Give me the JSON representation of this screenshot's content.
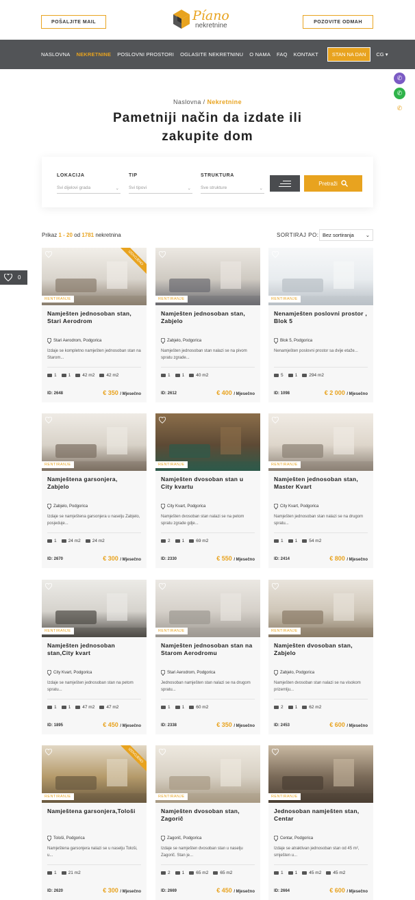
{
  "header": {
    "left_button": "POŠALJITE MAIL",
    "right_button": "POZOVITE ODMAH",
    "logo_main": "Píano",
    "logo_sub": "nekretnine"
  },
  "nav": {
    "items": [
      "NASLOVNA",
      "NEKRETNINE",
      "POSLOVNI PROSTORI",
      "OGLASITE NEKRETNINU",
      "O NAMA",
      "FAQ",
      "KONTAKT"
    ],
    "cta": "STAN NA DAN",
    "lang": "CG"
  },
  "favorites": {
    "count": "0"
  },
  "breadcrumb": {
    "home": "Naslovna",
    "sep": " / ",
    "current": "Nekretnine"
  },
  "hero": {
    "line1": "Pametniji način da izdate ili",
    "line2": "zakupite dom"
  },
  "search": {
    "location_label": "LOKACIJA",
    "location_value": "Svi dijelovi grada",
    "type_label": "TIP",
    "type_value": "Svi tipovi",
    "structure_label": "STRUKTURA",
    "structure_value": "Sve strukture",
    "submit": "Pretraži"
  },
  "results": {
    "prefix": "Prikaz",
    "from": "1",
    "dash": " - ",
    "to": "20",
    "of": "od",
    "total": "1781",
    "suffix": "nekretnina"
  },
  "sort": {
    "label": "SORTIRAJ PO:",
    "value": "Bez sortiranja"
  },
  "colors": {
    "accent": "#e8a31f",
    "nav": "#525457"
  },
  "listings": [
    {
      "title": "Namješten jednosoban stan, Stari Aerodrom",
      "location": "Stari Aerodrom, Podgorica",
      "desc": "Izdaje se kompletno namješten jednosoban stan na Starom...",
      "badge": "RENTIRANJE",
      "ribbon": "IZDVOJENO",
      "features": [
        "1",
        "1",
        "42 m2",
        "42 m2"
      ],
      "id": "ID: 2648",
      "price": "€ 350",
      "per": "/ Mjesečno"
    },
    {
      "title": "Namješten jednosoban stan, Zabjelo",
      "location": "Zabjelo, Podgorica",
      "desc": "Namješten jednosoban stan nalazi se na pivom spratu zgrade...",
      "badge": "RENTIRANJE",
      "ribbon": "",
      "features": [
        "1",
        "1",
        "40 m2"
      ],
      "id": "ID: 2612",
      "price": "€ 400",
      "per": "/ Mjesečno"
    },
    {
      "title": "Nenamješten poslovni prostor , Blok 5",
      "location": "Blok 5, Podgorica",
      "desc": "Nenamješten poslovni prostor sa dvije etaže...",
      "badge": "RENTIRANJE",
      "ribbon": "",
      "features": [
        "5",
        "1",
        "294 m2"
      ],
      "id": "ID: 1098",
      "price": "€ 2 000",
      "per": "/ Mjesečno"
    },
    {
      "title": "Namještena garsonjera, Zabjelo",
      "location": "Zabjelo, Podgorica",
      "desc": "Izdaje se namještena garsonjera u naselju Zabjelo, posjeduje...",
      "badge": "RENTIRANJE",
      "ribbon": "",
      "features": [
        "1",
        "24 m2",
        "24 m2"
      ],
      "id": "ID: 2670",
      "price": "€ 300",
      "per": "/ Mjesečno"
    },
    {
      "title": "Namješten dvosoban stan u City kvartu",
      "location": "City Kvart, Podgorica",
      "desc": "Namješten dvosoban stan nalazi se na petom spratu zgrade gdje...",
      "badge": "RENTIRANJE",
      "ribbon": "",
      "features": [
        "2",
        "1",
        "69 m2"
      ],
      "id": "ID: 2330",
      "price": "€ 550",
      "per": "/ Mjesečno"
    },
    {
      "title": "Namješten jednosoban stan, Master Kvart",
      "location": "City Kvart, Podgorica",
      "desc": "Namješten jednosoban stan nalazi se na drugom spratu...",
      "badge": "RENTIRANJE",
      "ribbon": "",
      "features": [
        "1",
        "1",
        "54 m2"
      ],
      "id": "ID: 2414",
      "price": "€ 800",
      "per": "/ Mjesečno"
    },
    {
      "title": "Namješten jednosoban stan,City kvart",
      "location": "City Kvart, Podgorica",
      "desc": "Izdaje se namješten jednosoban stan na petom spratu...",
      "badge": "RENTIRANJE",
      "ribbon": "",
      "features": [
        "1",
        "1",
        "47 m2",
        "47 m2"
      ],
      "id": "ID: 1895",
      "price": "€ 450",
      "per": "/ Mjesečno"
    },
    {
      "title": "Namješten jednosoban stan na Starom Aerodromu",
      "location": "Stari Aerodrom, Podgorica",
      "desc": "Jednosoban namješten stan nalazi se na drugom spratu...",
      "badge": "RENTIRANJE",
      "ribbon": "",
      "features": [
        "1",
        "1",
        "60 m2"
      ],
      "id": "ID: 2338",
      "price": "€ 350",
      "per": "/ Mjesečno"
    },
    {
      "title": "Namješten dvosoban stan, Zabjelo",
      "location": "Zabjelo, Podgorica",
      "desc": "Namješten dvosoban stan nalazi se na visokom prizemlju...",
      "badge": "RENTIRANJE",
      "ribbon": "",
      "features": [
        "2",
        "1",
        "62 m2"
      ],
      "id": "ID: 2453",
      "price": "€ 600",
      "per": "/ Mjesečno"
    },
    {
      "title": "Namještena garsonjera,Tološi",
      "location": "Tološi, Podgorica",
      "desc": "Namještena garsonjera nalazi se u naselju Tološi, u...",
      "badge": "RENTIRANJE",
      "ribbon": "IZDVOJENO",
      "features": [
        "1",
        "21 m2"
      ],
      "id": "ID: 2620",
      "price": "€ 300",
      "per": "/ Mjesečno"
    },
    {
      "title": "Namješten dvosoban stan, Zagorič",
      "location": "Zagorič, Podgorica",
      "desc": "Izdaje se namješten dvosoban stan u naselju Zagorič. Stan je...",
      "badge": "RENTIRANJE",
      "ribbon": "",
      "features": [
        "2",
        "1",
        "65 m2",
        "65 m2"
      ],
      "id": "ID: 2669",
      "price": "€ 450",
      "per": "/ Mjesečno"
    },
    {
      "title": "Jednosoban namješten stan, Centar",
      "location": "Centar, Podgorica",
      "desc": "Izdaje se atraktivan jednosoban stan od 45 m², smješten u...",
      "badge": "RENTIRANJE",
      "ribbon": "",
      "features": [
        "1",
        "1",
        "45 m2",
        "45 m2"
      ],
      "id": "ID: 2664",
      "price": "€ 600",
      "per": "/ Mjesečno"
    }
  ]
}
